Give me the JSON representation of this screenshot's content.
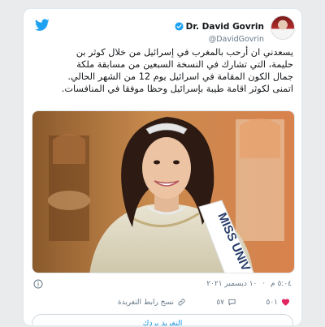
{
  "author": {
    "name": "Dr. David Govrin",
    "handle": "@DavidGovrin"
  },
  "tweet": {
    "lines": [
      "يسعدني ان أرحب بالمغرب في إسرائيل من خلال كوثر بن",
      "حليمة، التي تشارك في النسخة السبعين من مسابقة ملكة",
      "جمال الكون المقامة في اسرائيل يوم 12 من الشهر الحالي.",
      "اتمنى لكوثر اقامة طيبة بإسرائيل وحظا موفقا في المنافسات."
    ]
  },
  "photo": {
    "sash_text": "MISS UNIV"
  },
  "meta": {
    "time": "٥:٠٤ م",
    "separator": "·",
    "date": "١٠ ديسمبر ٢٠٢١"
  },
  "actions": {
    "like_count": "٥٠١",
    "reply_count": "٥٧",
    "copy_link_label": "نسخ رابط التغريدة"
  },
  "reply_button": {
    "label": "التغريد بردك"
  },
  "colors": {
    "twitter_blue": "#1da1f2",
    "like_red": "#e0245e",
    "text_primary": "#14171a",
    "text_secondary": "#657786"
  }
}
